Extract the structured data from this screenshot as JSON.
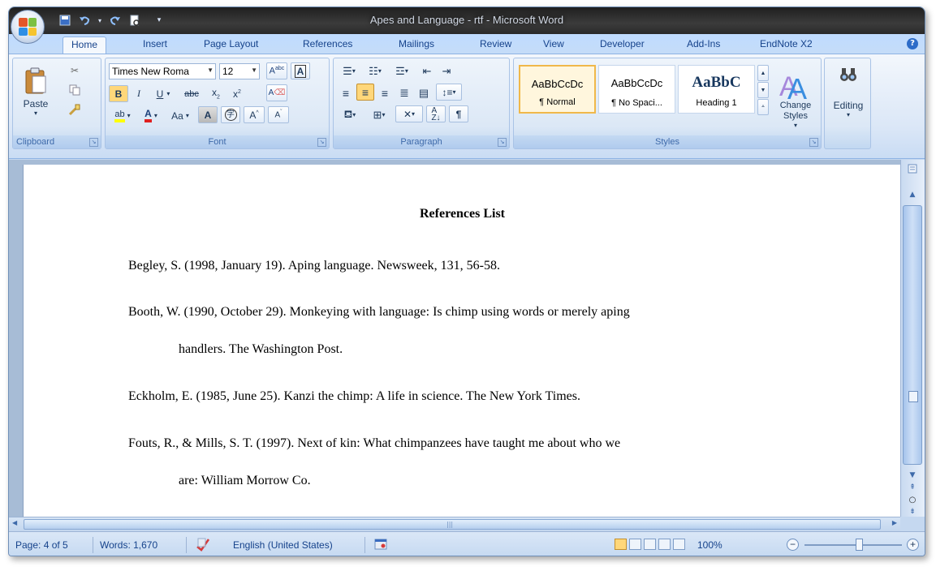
{
  "window": {
    "title": "Apes and Language - rtf - Microsoft Word"
  },
  "quick_access": {
    "icons": [
      "save-icon",
      "undo-icon",
      "redo-icon",
      "print-preview-icon",
      "customize-icon"
    ]
  },
  "tabs": [
    {
      "label": "Home",
      "active": true
    },
    {
      "label": "Insert"
    },
    {
      "label": "Page Layout"
    },
    {
      "label": "References"
    },
    {
      "label": "Mailings"
    },
    {
      "label": "Review"
    },
    {
      "label": "View"
    },
    {
      "label": "Developer"
    },
    {
      "label": "Add-Ins"
    },
    {
      "label": "EndNote X2"
    }
  ],
  "ribbon": {
    "clipboard": {
      "group_label": "Clipboard",
      "paste_label": "Paste"
    },
    "font": {
      "group_label": "Font",
      "font_name": "Times New Roma",
      "font_size": "12",
      "change_case_label": "Aa"
    },
    "paragraph": {
      "group_label": "Paragraph"
    },
    "styles": {
      "group_label": "Styles",
      "items": [
        {
          "sample": "AaBbCcDc",
          "name": "¶ Normal"
        },
        {
          "sample": "AaBbCcDc",
          "name": "¶ No Spaci..."
        },
        {
          "sample": "AaBbC",
          "name": "Heading 1"
        }
      ],
      "change_styles_label": "Change Styles"
    },
    "editing": {
      "label": "Editing"
    }
  },
  "document": {
    "title": "References List",
    "references": [
      {
        "lines": [
          "Begley, S. (1998, January 19). Aping language. Newsweek, 131, 56-58."
        ]
      },
      {
        "lines": [
          "Booth, W. (1990, October 29). Monkeying with language: Is chimp using words or merely aping",
          "handlers. The Washington Post."
        ]
      },
      {
        "lines": [
          "Eckholm, E. (1985, June 25). Kanzi the chimp: A life in science. The New York Times."
        ]
      },
      {
        "lines": [
          "Fouts, R., & Mills, S. T. (1997). Next of kin: What chimpanzees have taught me about who we",
          "are: William Morrow Co."
        ]
      }
    ]
  },
  "status_bar": {
    "page": "Page: 4 of 5",
    "words": "Words: 1,670",
    "language": "English (United States)",
    "zoom": "100%",
    "zoom_level": 100
  },
  "colors": {
    "ribbon_bg": "#dbe7f7",
    "title_bar": "#2a2a2a",
    "spelling_error": "#d84040",
    "grammar_error": "#3b9a3b",
    "selected_style": "#f0b84a"
  }
}
